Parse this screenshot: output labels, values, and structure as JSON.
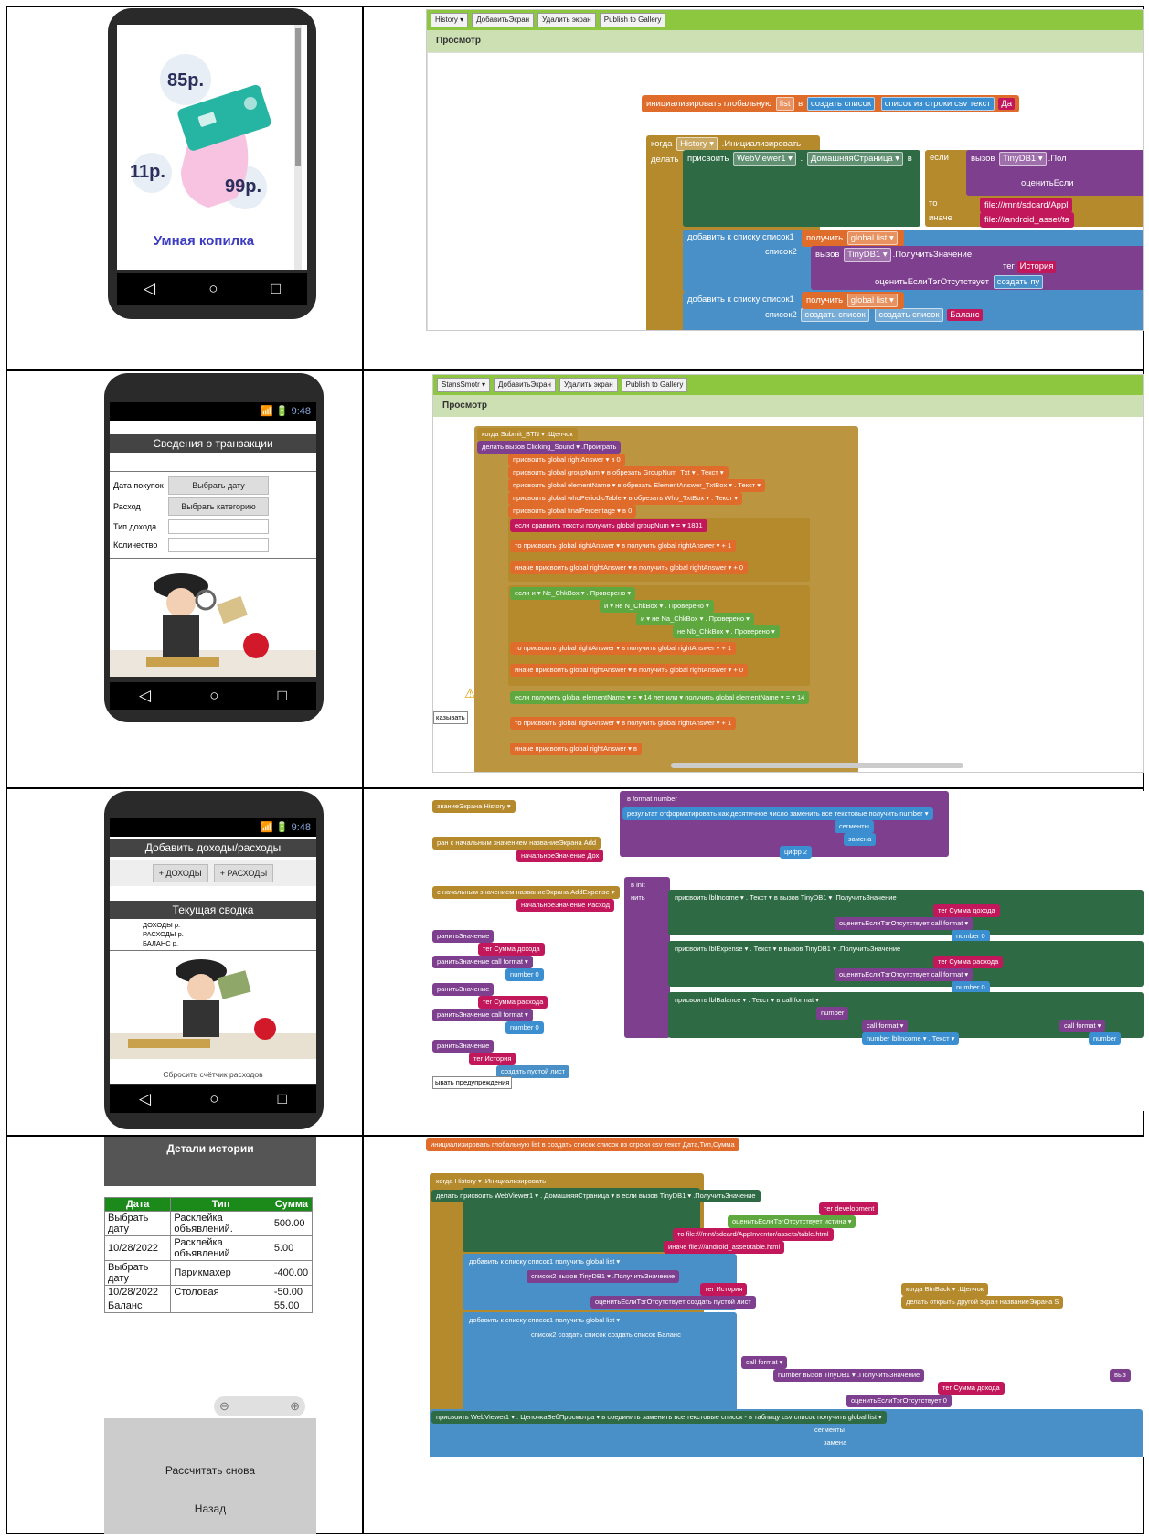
{
  "row1": {
    "phone": {
      "prices": [
        "85р.",
        "11р.",
        "99р."
      ],
      "app_name": "Умная копилка"
    },
    "editor": {
      "toolbar": [
        "History ▾",
        "ДобавитьЭкран",
        "Удалить экран",
        "Publish to Gallery"
      ],
      "panel_title": "Просмотр",
      "blocks": {
        "init": "инициализировать глобальную",
        "list_var": "list",
        "in": "в",
        "create_list": "создать список",
        "csv": "список из строки csv  текст",
        "csv_cut": "Да",
        "when": "когда",
        "history": "History ▾",
        "initialize": ".Инициализировать",
        "do": "делать",
        "set": "присвоить",
        "webviewer": "WebViewer1 ▾",
        "homepage": "ДомашняяСтраница ▾",
        "in2": "в",
        "if": "если",
        "call": "вызов",
        "tinydb": "TinyDB1 ▾",
        ".get": ".Пол",
        "evalif": "оценитьЕсли",
        "then": "то",
        "else": "иначе",
        "path1": "file:///mnt/sdcard/Appl",
        "path2": "file:///android_asset/ta",
        "add_to_list": "добавить к списку  список1",
        "get": "получить",
        "global_list": "global list ▾",
        "list2": "список2",
        "getvalue": ".ПолучитьЗначение",
        "tag": "тег",
        "history_str": "История",
        "evalmissing": "оценитьЕслиТэгОтсутствует",
        "create_pu": "создать пу",
        "balance": "Баланс"
      }
    }
  },
  "row2": {
    "phone": {
      "time": "9:48",
      "title": "Сведения о транзакции",
      "rows": [
        {
          "label": "Дата покупок",
          "btn": "Выбрать дату"
        },
        {
          "label": "Расход",
          "btn": "Выбрать категорию"
        },
        {
          "label": "Тип дохода",
          "btn": ""
        },
        {
          "label": "Количество",
          "btn": ""
        }
      ]
    },
    "editor": {
      "toolbar": [
        "StansSmotr ▾",
        "ДобавитьЭкран",
        "Удалить экран",
        "Publish to Gallery"
      ],
      "panel_title": "Просмотр",
      "lines": [
        "когда  Submit_BTN ▾ .Щелчок",
        "делать  вызов  Clicking_Sound ▾ .Проиграть",
        "присвоить  global rightAnswer ▾  в  0",
        "присвоить  global groupNum ▾  в  обрезать  GroupNum_Txt ▾ . Текст ▾",
        "присвоить  global elementName ▾  в  обрезать  ElementAnswer_TxtBox ▾ . Текст ▾",
        "присвоить  global whoPeriodicTable ▾  в  обрезать  Who_TxtBox ▾ . Текст ▾",
        "присвоить  global finalPercentage ▾  в  0",
        "если  сравнить тексты  получить  global groupNum ▾  = ▾  1831",
        "то  присвоить  global rightAnswer ▾  в  получить  global rightAnswer ▾  +  1",
        "иначе  присвоить  global rightAnswer ▾  в  получить  global rightAnswer ▾  +  0",
        "если  и ▾  Ne_ChkBox ▾ . Проверено ▾",
        "и ▾  не  N_ChkBox ▾ . Проверено ▾",
        "и ▾  не  Na_ChkBox ▾ . Проверено ▾",
        "не  Nb_ChkBox ▾ . Проверено ▾",
        "то  присвоить  global rightAnswer ▾  в  получить  global rightAnswer ▾  +  1",
        "иначе  присвоить  global rightAnswer ▾  в  получить  global rightAnswer ▾  +  0",
        "если  получить  global elementName ▾  = ▾  14 лет  или ▾  получить  global elementName ▾  = ▾  14",
        "то  присвоить  global rightAnswer ▾  в  получить  global rightAnswer ▾  +  1",
        "иначе  присвоить  global rightAnswer ▾  в"
      ],
      "show_warnings": "казывать"
    }
  },
  "row3": {
    "phone": {
      "time": "9:48",
      "title": "Добавить доходы/расходы",
      "btn_income": "+ ДОХОДЫ",
      "btn_expense": "+ РАСХОДЫ",
      "summary": "Текущая сводка",
      "lines": [
        {
          "k": "ДОХОДЫ",
          "v": "р."
        },
        {
          "k": "РАСХОДЫ",
          "v": "р."
        },
        {
          "k": "БАЛАНС",
          "v": "р."
        }
      ],
      "reset": "Сбросить счётчик расходов"
    },
    "editor": {
      "lines": [
        "званиеЭкрана  History ▾",
        "ран с начальным значением  названиеЭкрана  Add",
        "начальноеЗначение  Дох",
        "с начальным значением  названиеЭкрана  AddExpense ▾",
        "начальноеЗначение  Расход",
        "ранитьЗначение",
        "тег  Сумма дохода",
        "ранитьЗначение  call  format ▾",
        "number  0",
        "ранитьЗначение",
        "тег  Сумма расхода",
        "ранитьЗначение  call  format ▾",
        "number  0",
        "ранитьЗначение",
        "тег  История",
        "создать пустой лист",
        "ывать предупреждения",
        "в  format  number",
        "результат  отформатировать как десятичное число  заменить все текстовые  получить  number ▾",
        "сегменты",
        "замена",
        "цифр  2",
        "в  init",
        "нить",
        "присвоить  lblIncome ▾ . Текст ▾  в  вызов  TinyDB1 ▾ .ПолучитьЗначение",
        "тег  Сумма дохода",
        "оценитьЕслиТэгОтсутствует  call  format ▾",
        "number  0",
        "присвоить  lblExpense ▾ . Текст ▾  в  вызов  TinyDB1 ▾ .ПолучитьЗначение",
        "тег  Сумма расхода",
        "оценитьЕслиТэгОтсутствует  call  format ▾",
        "number  0",
        "присвоить  lblBalance ▾ . Текст ▾  в  call  format ▾",
        "number",
        "call  format ▾",
        "number  lblIncome ▾ . Текст ▾",
        "call  format ▾",
        "number"
      ]
    }
  },
  "row4": {
    "phone": {
      "title": "Детали истории",
      "headers": [
        "Дата",
        "Тип",
        "Сумма"
      ],
      "rows": [
        [
          "Выбрать дату",
          "Расклейка объявлений.",
          "500.00"
        ],
        [
          "10/28/2022",
          "Расклейка объявлений",
          "5.00"
        ],
        [
          "Выбрать дату",
          "Парикмахер",
          "-400.00"
        ],
        [
          "10/28/2022",
          "Столовая",
          "-50.00"
        ],
        [
          "Баланс",
          "",
          "55.00"
        ]
      ],
      "recalc": "Рассчитать снова",
      "back": "Назад"
    },
    "editor": {
      "lines": [
        "инициализировать глобальную  list  в  создать список  список из строки csv  текст  Дата,Тип,Сумма",
        "когда  History ▾ .Инициализировать",
        "делать  присвоить  WebViewer1 ▾ . ДомашняяСтраница ▾  в  если  вызов  TinyDB1 ▾ .ПолучитьЗначение",
        "тег  development",
        "оценитьЕслиТэгОтсутствует  истина ▾",
        "то  file:///mnt/sdcard/AppInventor/assets/table.html",
        "иначе  file:///android_asset/table.html",
        "добавить к списку  список1  получить  global list ▾",
        "список2  вызов  TinyDB1 ▾ .ПолучитьЗначение",
        "тег  История",
        "оценитьЕслиТэгОтсутствует  создать пустой лист",
        "добавить к списку  список1  получить  global list ▾",
        "список2  создать список  создать список  Баланс",
        "call  format ▾",
        "number  вызов  TinyDB1 ▾ .ПолучитьЗначение",
        "тег  Сумма дохода",
        "оценитьЕслиТэгОтсутствует  0",
        "присвоить  WebViewer1 ▾ . ЦепочкаВебПросмотра ▾  в  соединить  заменить все текстовые  список - в таблицу csv  список  получить  global list ▾",
        "сегменты",
        "замена",
        "когда  BtnBack ▾ .Щелчок",
        "делать  открыть другой экран  названиеЭкрана  S",
        "выз"
      ]
    }
  }
}
